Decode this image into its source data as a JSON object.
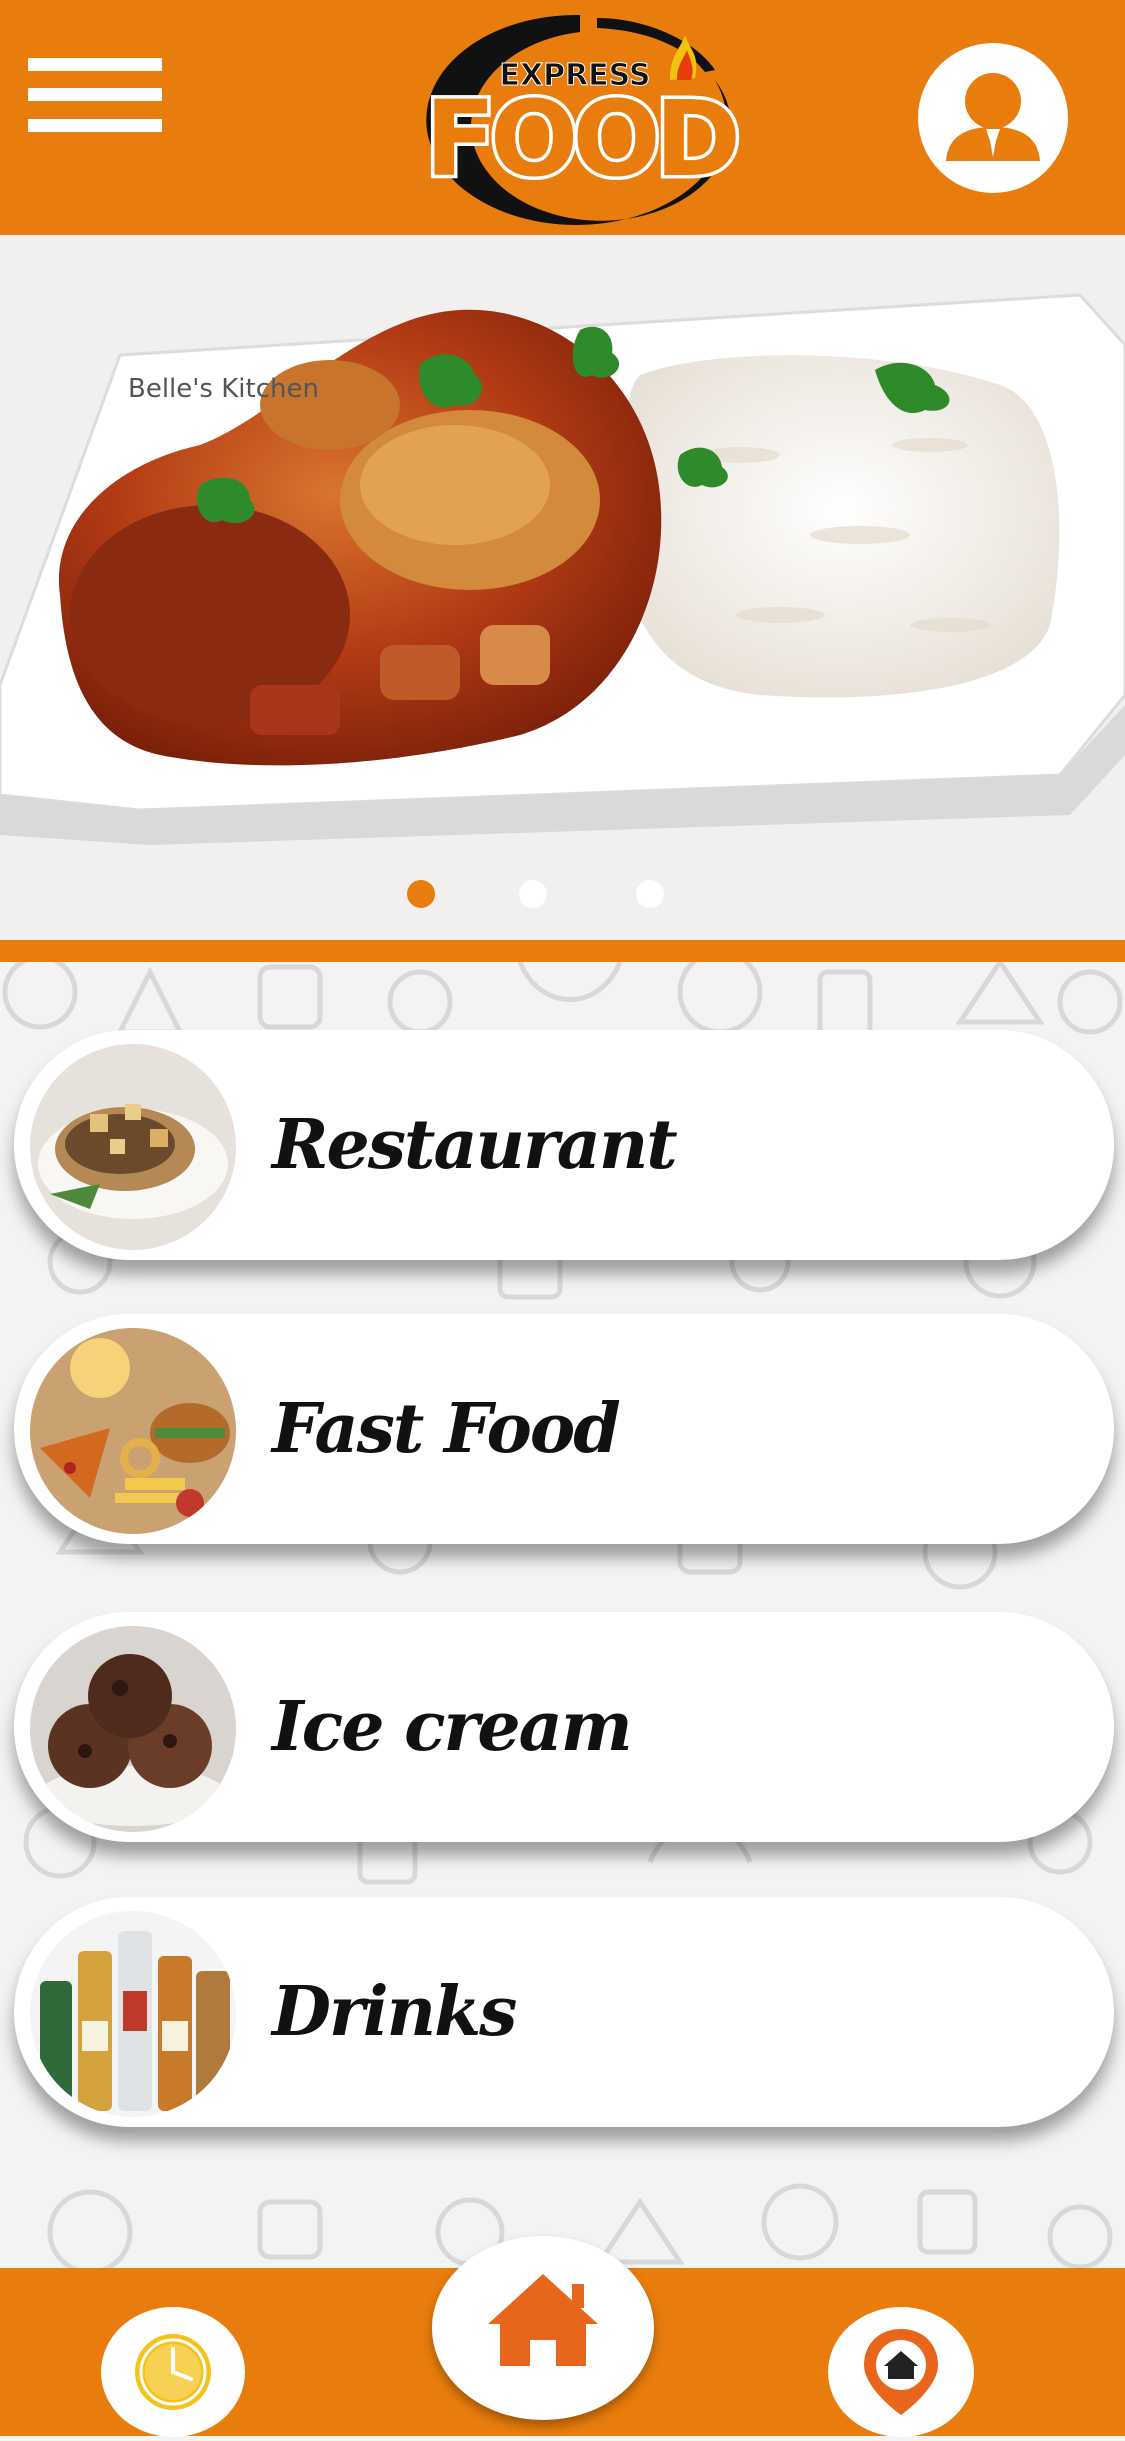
{
  "header": {
    "logo_top": "EXPRESS",
    "logo_main": "FOOD",
    "menu_icon": "hamburger-menu-icon",
    "profile_icon": "user-profile-icon"
  },
  "hero": {
    "watermark": "Belle's Kitchen",
    "slides_total": 3,
    "active_slide": 1
  },
  "categories": [
    {
      "label": "Restaurant"
    },
    {
      "label": "Fast Food"
    },
    {
      "label": "Ice cream"
    },
    {
      "label": "Drinks"
    }
  ],
  "footer": {
    "left_icon": "clock-icon",
    "center_icon": "home-icon",
    "right_icon": "location-home-icon"
  },
  "colors": {
    "accent": "#E87C0C",
    "white": "#FFFFFF"
  }
}
